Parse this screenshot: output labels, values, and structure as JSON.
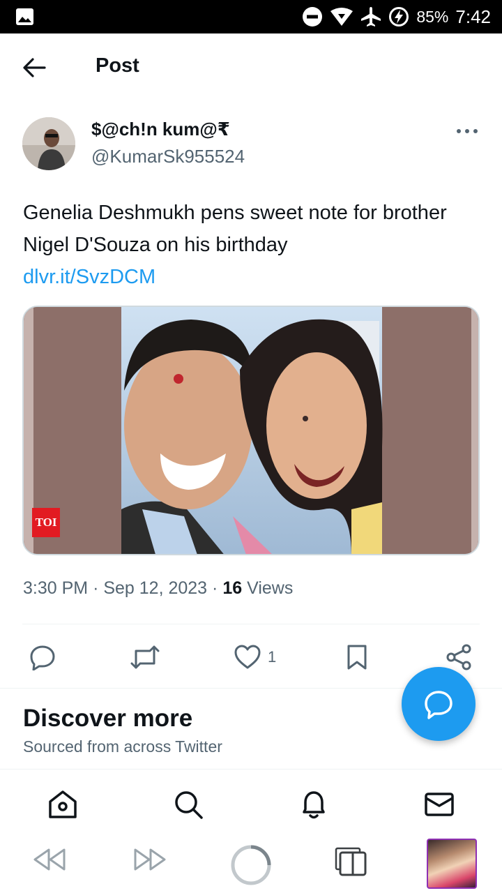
{
  "status_bar": {
    "battery": "85%",
    "time": "7:42",
    "icons": [
      "gallery-icon",
      "dnd-icon",
      "wifi-icon",
      "airplane-icon",
      "battery-charging-icon"
    ]
  },
  "header": {
    "title": "Post"
  },
  "post": {
    "author_name": "$@ch!n kum@₹",
    "author_handle": "@KumarSk955524",
    "text": "Genelia Deshmukh pens sweet note for brother Nigel D'Souza on his birthday",
    "link": "dlvr.it/SvzDCM",
    "media_badge": "TOI",
    "time": "3:30 PM",
    "date": "Sep 12, 2023",
    "views_count": "16",
    "views_label": "Views"
  },
  "actions": {
    "like_count": "1"
  },
  "discover": {
    "title": "Discover more",
    "subtitle": "Sourced from across Twitter"
  },
  "colors": {
    "accent": "#1d9bf0",
    "text": "#0f1419",
    "secondary": "#536471",
    "toi_red": "#e21b22"
  }
}
